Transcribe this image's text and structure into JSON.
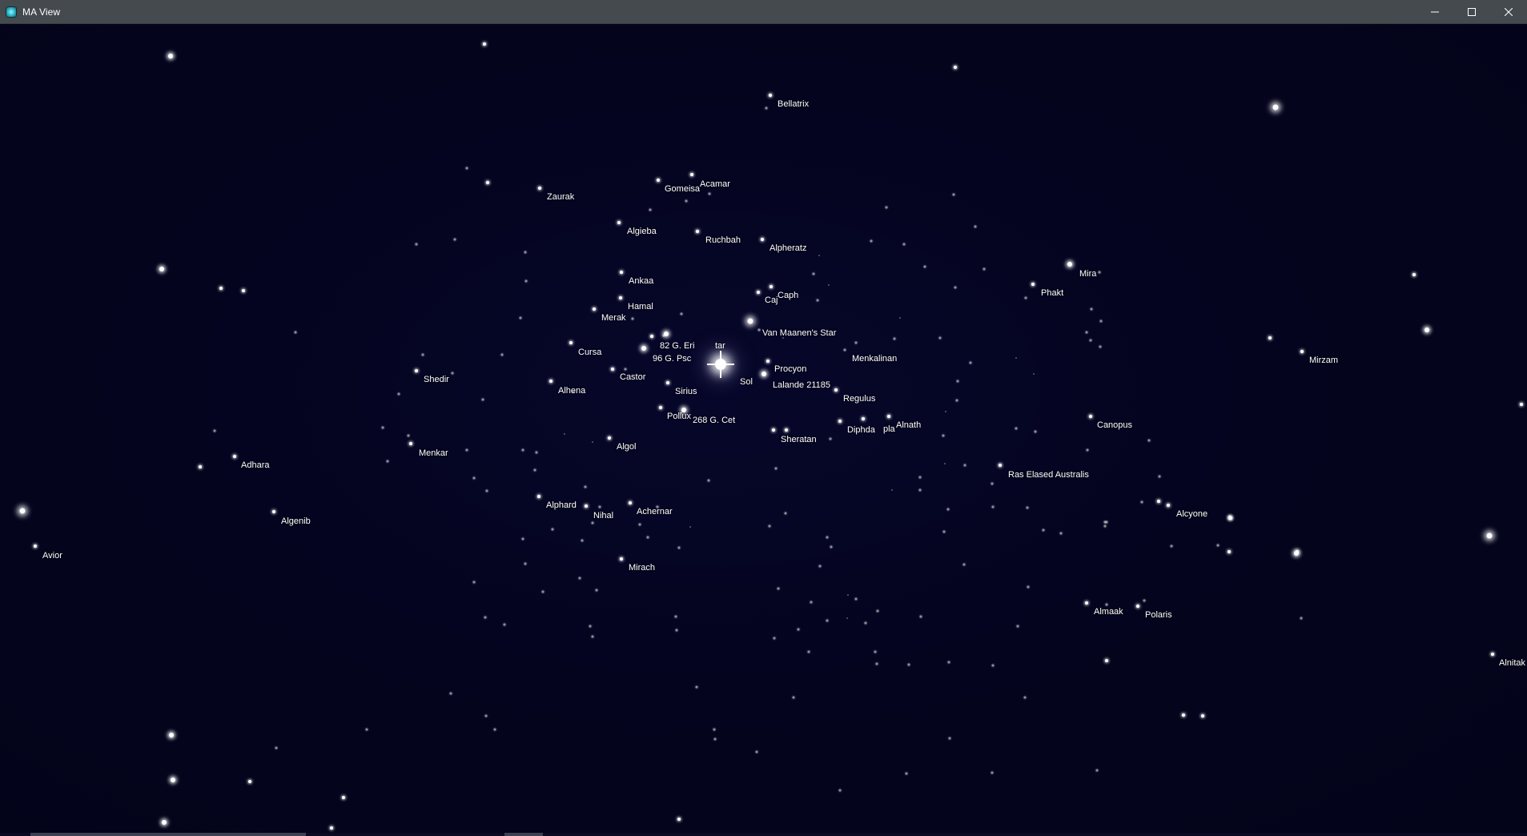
{
  "window": {
    "title": "MA View",
    "icon": "app-icon",
    "colors": {
      "titlebar": "#454a4e",
      "sky": "#04031a",
      "star": "#ffffff",
      "label": "#ffffff"
    }
  },
  "controls": {
    "minimize_icon": "minimize-icon",
    "maximize_icon": "maximize-icon",
    "close_icon": "close-icon"
  },
  "labels": {
    "bellatrix": "Bellatrix",
    "zaurak": "Zaurak",
    "gomeisa": "Gomeisa",
    "acamar": "Acamar",
    "algieba": "Algieba",
    "ruchbah": "Ruchbah",
    "alpheratz": "Alpheratz",
    "ankaa": "Ankaa",
    "mira": "Mira",
    "phakt": "Phakt",
    "caph": "Caph",
    "caj": "Caj",
    "hamal": "Hamal",
    "merak": "Merak",
    "van_maanen": "Van Maanen's Star",
    "g82_eri": "82 G. Eri",
    "tar": "tar",
    "cursa": "Cursa",
    "g96_psc": "96 G. Psc",
    "menkalinan": "Menkalinan",
    "mirzam": "Mirzam",
    "procyon": "Procyon",
    "shedir": "Shedir",
    "castor": "Castor",
    "sol": "Sol",
    "lalande": "Lalande 21185",
    "alhena": "Alhena",
    "sirius": "Sirius",
    "regulus": "Regulus",
    "pollux": "Pollux",
    "g268_cet": "268 G. Cet",
    "canopus": "Canopus",
    "alnath": "Alnath",
    "diphda": "Diphda",
    "pla": "pla",
    "sheratan": "Sheratan",
    "algol": "Algol",
    "menkar": "Menkar",
    "adhara": "Adhara",
    "ras_elased": "Ras Elased Australis",
    "alphard": "Alphard",
    "nihal": "Nihal",
    "achernar": "Achernar",
    "alcyone": "Alcyone",
    "algenib": "Algenib",
    "avior": "Avior",
    "mirach": "Mirach",
    "almaak": "Almaak",
    "polaris": "Polaris",
    "alnitak": "Alnitak"
  }
}
